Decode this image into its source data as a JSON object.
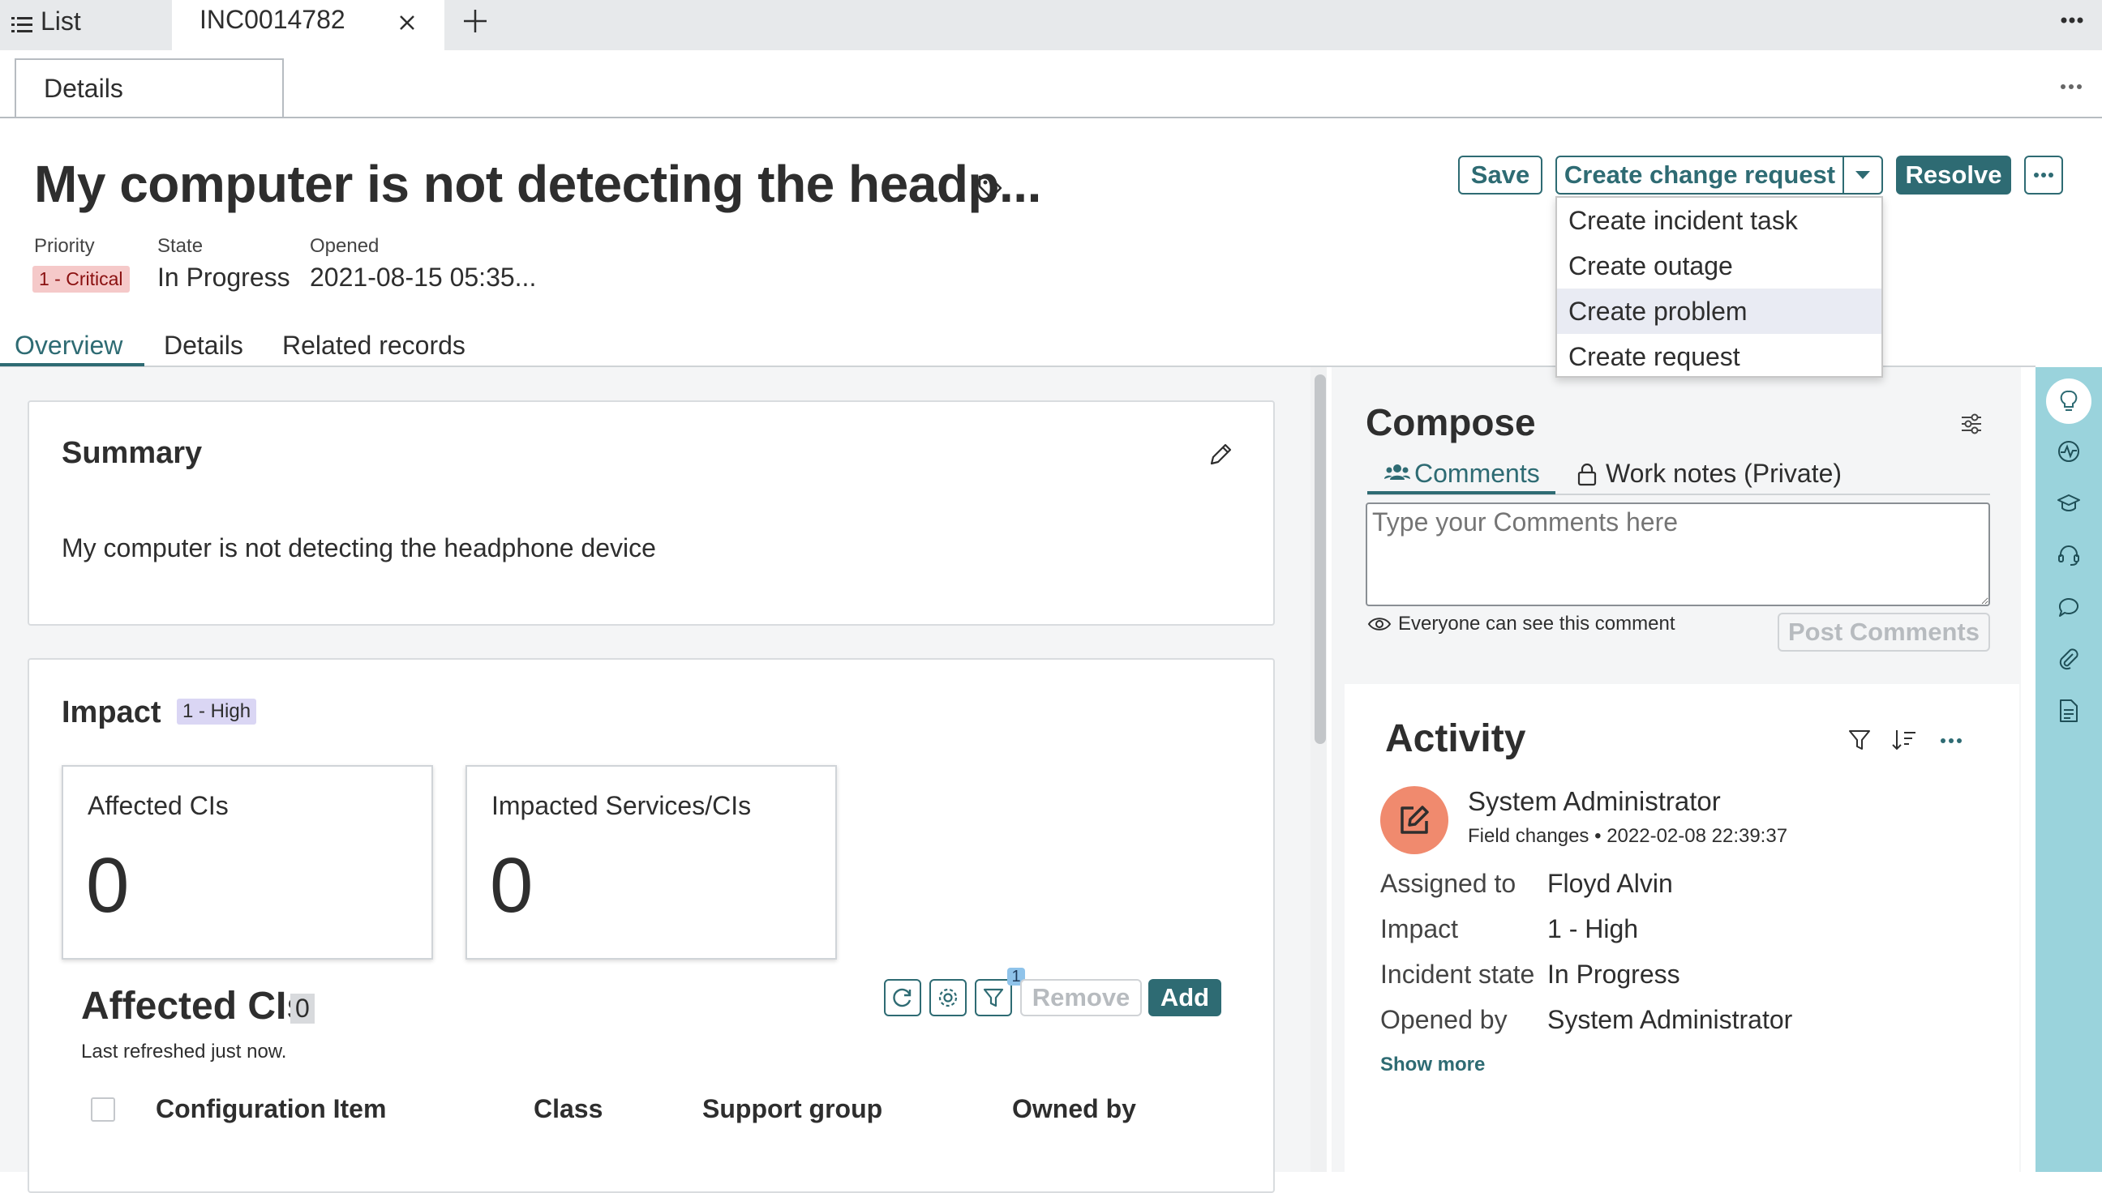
{
  "top_tabs": {
    "list_label": "List",
    "incident_label": "INC0014782"
  },
  "sub_tabs": {
    "details_label": "Details"
  },
  "header": {
    "title": "My computer is not detecting the headp...",
    "priority_label": "Priority",
    "priority_value": "1 - Critical",
    "state_label": "State",
    "state_value": "In Progress",
    "opened_label": "Opened",
    "opened_value": "2021-08-15 05:35..."
  },
  "actions": {
    "save": "Save",
    "create_change_request": "Create change request",
    "resolve": "Resolve",
    "menu_items": [
      "Create incident task",
      "Create outage",
      "Create problem",
      "Create request"
    ],
    "highlighted_index": 2
  },
  "nav_tabs": [
    "Overview",
    "Details",
    "Related records"
  ],
  "summary": {
    "title": "Summary",
    "text": "My computer is not detecting the headphone device"
  },
  "impact": {
    "title": "Impact",
    "badge": "1 - High",
    "affected_cis_label": "Affected CIs",
    "affected_cis_value": "0",
    "impacted_services_label": "Impacted Services/CIs",
    "impacted_services_value": "0"
  },
  "affected_cis_list": {
    "title": "Affected CIs",
    "count": "0",
    "refreshed": "Last refreshed just now.",
    "filter_count": "1",
    "remove_label": "Remove",
    "add_label": "Add",
    "columns": [
      "Configuration Item",
      "Class",
      "Support group",
      "Owned by"
    ]
  },
  "compose": {
    "title": "Compose",
    "tab_comments": "Comments",
    "tab_work_notes": "Work notes (Private)",
    "placeholder": "Type your Comments here",
    "visibility_note": "Everyone can see this comment",
    "post_label": "Post Comments"
  },
  "activity": {
    "title": "Activity",
    "author": "System Administrator",
    "entry_type": "Field changes",
    "timestamp": "2022-02-08 22:39:37",
    "fields": [
      {
        "label": "Assigned to",
        "value": "Floyd Alvin"
      },
      {
        "label": "Impact",
        "value": "1 - High"
      },
      {
        "label": "Incident state",
        "value": "In Progress"
      },
      {
        "label": "Opened by",
        "value": "System Administrator"
      }
    ],
    "show_more": "Show more"
  },
  "colors": {
    "brand_teal": "#2e6b73",
    "priority_bg": "#f5c9c9",
    "impact_bg": "#dad6f4",
    "avatar_bg": "#f08a6e",
    "sidebar_bg": "#9ad3dc",
    "menu_highlight": "#e9ebf3"
  }
}
